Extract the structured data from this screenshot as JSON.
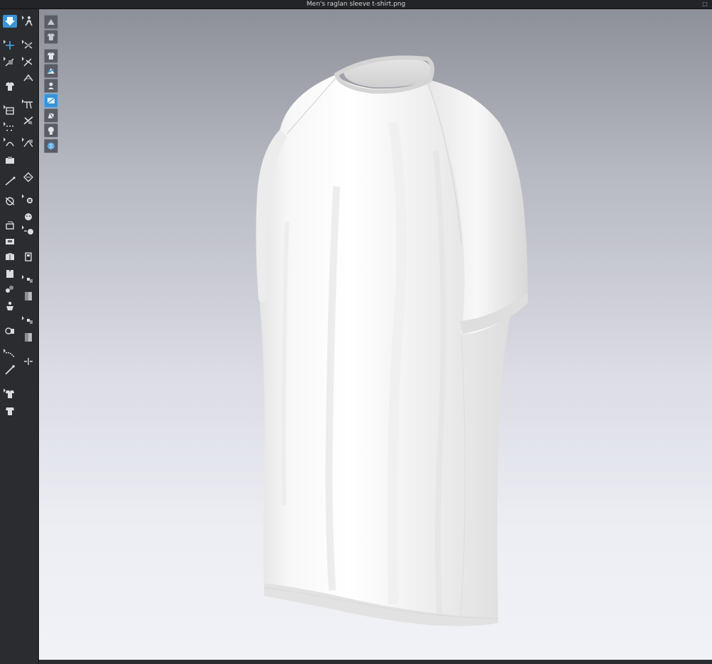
{
  "window": {
    "title": "Men's raglan sleeve t-shirt.png"
  },
  "toolbar": {
    "tools": [
      "garment-select-icon",
      "avatar-pose-icon",
      "transform-icon",
      "edit-pattern-icon",
      "tack-icon",
      "edit-point-icon",
      "fold-icon",
      "simulation-icon",
      "grid-icon",
      "sewing-icon",
      "pin-icon",
      "segment-sewing-icon",
      "edit-curve-icon",
      "free-sewing-icon",
      "material-icon",
      "stitch-icon",
      "pattern-icon",
      "line-icon",
      "measure-icon",
      "zipper-icon",
      "button-icon",
      "topstitch-icon",
      "buttonhole-icon",
      "print-icon",
      "layer-icon",
      "garment-icon",
      "fabric-icon",
      "shirt-icon",
      "brush-icon",
      "avatar-icon",
      "tape-icon",
      "rigging-icon",
      "split-icon",
      "pen-icon",
      "fitting-icon",
      "front-view-icon",
      "back-view-icon"
    ]
  },
  "viewport": {
    "buttons": [
      "show-avatar-icon",
      "show-garment-icon",
      "texture-view-icon",
      "colour-view-icon",
      "light-view-icon",
      "blue-panel-icon",
      "pattern-view-icon",
      "head-avatar-icon",
      "globe-mesh-icon"
    ],
    "active_buttons": [
      3,
      5
    ],
    "garment_color": "#f3f3f3"
  }
}
